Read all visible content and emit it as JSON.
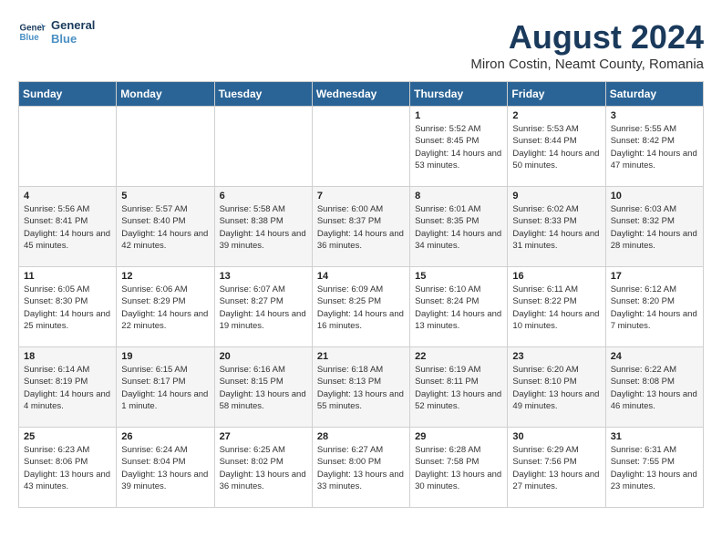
{
  "header": {
    "logo_line1": "General",
    "logo_line2": "Blue",
    "month": "August 2024",
    "location": "Miron Costin, Neamt County, Romania"
  },
  "weekdays": [
    "Sunday",
    "Monday",
    "Tuesday",
    "Wednesday",
    "Thursday",
    "Friday",
    "Saturday"
  ],
  "weeks": [
    [
      {
        "day": "",
        "info": ""
      },
      {
        "day": "",
        "info": ""
      },
      {
        "day": "",
        "info": ""
      },
      {
        "day": "",
        "info": ""
      },
      {
        "day": "1",
        "info": "Sunrise: 5:52 AM\nSunset: 8:45 PM\nDaylight: 14 hours and 53 minutes."
      },
      {
        "day": "2",
        "info": "Sunrise: 5:53 AM\nSunset: 8:44 PM\nDaylight: 14 hours and 50 minutes."
      },
      {
        "day": "3",
        "info": "Sunrise: 5:55 AM\nSunset: 8:42 PM\nDaylight: 14 hours and 47 minutes."
      }
    ],
    [
      {
        "day": "4",
        "info": "Sunrise: 5:56 AM\nSunset: 8:41 PM\nDaylight: 14 hours and 45 minutes."
      },
      {
        "day": "5",
        "info": "Sunrise: 5:57 AM\nSunset: 8:40 PM\nDaylight: 14 hours and 42 minutes."
      },
      {
        "day": "6",
        "info": "Sunrise: 5:58 AM\nSunset: 8:38 PM\nDaylight: 14 hours and 39 minutes."
      },
      {
        "day": "7",
        "info": "Sunrise: 6:00 AM\nSunset: 8:37 PM\nDaylight: 14 hours and 36 minutes."
      },
      {
        "day": "8",
        "info": "Sunrise: 6:01 AM\nSunset: 8:35 PM\nDaylight: 14 hours and 34 minutes."
      },
      {
        "day": "9",
        "info": "Sunrise: 6:02 AM\nSunset: 8:33 PM\nDaylight: 14 hours and 31 minutes."
      },
      {
        "day": "10",
        "info": "Sunrise: 6:03 AM\nSunset: 8:32 PM\nDaylight: 14 hours and 28 minutes."
      }
    ],
    [
      {
        "day": "11",
        "info": "Sunrise: 6:05 AM\nSunset: 8:30 PM\nDaylight: 14 hours and 25 minutes."
      },
      {
        "day": "12",
        "info": "Sunrise: 6:06 AM\nSunset: 8:29 PM\nDaylight: 14 hours and 22 minutes."
      },
      {
        "day": "13",
        "info": "Sunrise: 6:07 AM\nSunset: 8:27 PM\nDaylight: 14 hours and 19 minutes."
      },
      {
        "day": "14",
        "info": "Sunrise: 6:09 AM\nSunset: 8:25 PM\nDaylight: 14 hours and 16 minutes."
      },
      {
        "day": "15",
        "info": "Sunrise: 6:10 AM\nSunset: 8:24 PM\nDaylight: 14 hours and 13 minutes."
      },
      {
        "day": "16",
        "info": "Sunrise: 6:11 AM\nSunset: 8:22 PM\nDaylight: 14 hours and 10 minutes."
      },
      {
        "day": "17",
        "info": "Sunrise: 6:12 AM\nSunset: 8:20 PM\nDaylight: 14 hours and 7 minutes."
      }
    ],
    [
      {
        "day": "18",
        "info": "Sunrise: 6:14 AM\nSunset: 8:19 PM\nDaylight: 14 hours and 4 minutes."
      },
      {
        "day": "19",
        "info": "Sunrise: 6:15 AM\nSunset: 8:17 PM\nDaylight: 14 hours and 1 minute."
      },
      {
        "day": "20",
        "info": "Sunrise: 6:16 AM\nSunset: 8:15 PM\nDaylight: 13 hours and 58 minutes."
      },
      {
        "day": "21",
        "info": "Sunrise: 6:18 AM\nSunset: 8:13 PM\nDaylight: 13 hours and 55 minutes."
      },
      {
        "day": "22",
        "info": "Sunrise: 6:19 AM\nSunset: 8:11 PM\nDaylight: 13 hours and 52 minutes."
      },
      {
        "day": "23",
        "info": "Sunrise: 6:20 AM\nSunset: 8:10 PM\nDaylight: 13 hours and 49 minutes."
      },
      {
        "day": "24",
        "info": "Sunrise: 6:22 AM\nSunset: 8:08 PM\nDaylight: 13 hours and 46 minutes."
      }
    ],
    [
      {
        "day": "25",
        "info": "Sunrise: 6:23 AM\nSunset: 8:06 PM\nDaylight: 13 hours and 43 minutes."
      },
      {
        "day": "26",
        "info": "Sunrise: 6:24 AM\nSunset: 8:04 PM\nDaylight: 13 hours and 39 minutes."
      },
      {
        "day": "27",
        "info": "Sunrise: 6:25 AM\nSunset: 8:02 PM\nDaylight: 13 hours and 36 minutes."
      },
      {
        "day": "28",
        "info": "Sunrise: 6:27 AM\nSunset: 8:00 PM\nDaylight: 13 hours and 33 minutes."
      },
      {
        "day": "29",
        "info": "Sunrise: 6:28 AM\nSunset: 7:58 PM\nDaylight: 13 hours and 30 minutes."
      },
      {
        "day": "30",
        "info": "Sunrise: 6:29 AM\nSunset: 7:56 PM\nDaylight: 13 hours and 27 minutes."
      },
      {
        "day": "31",
        "info": "Sunrise: 6:31 AM\nSunset: 7:55 PM\nDaylight: 13 hours and 23 minutes."
      }
    ]
  ]
}
